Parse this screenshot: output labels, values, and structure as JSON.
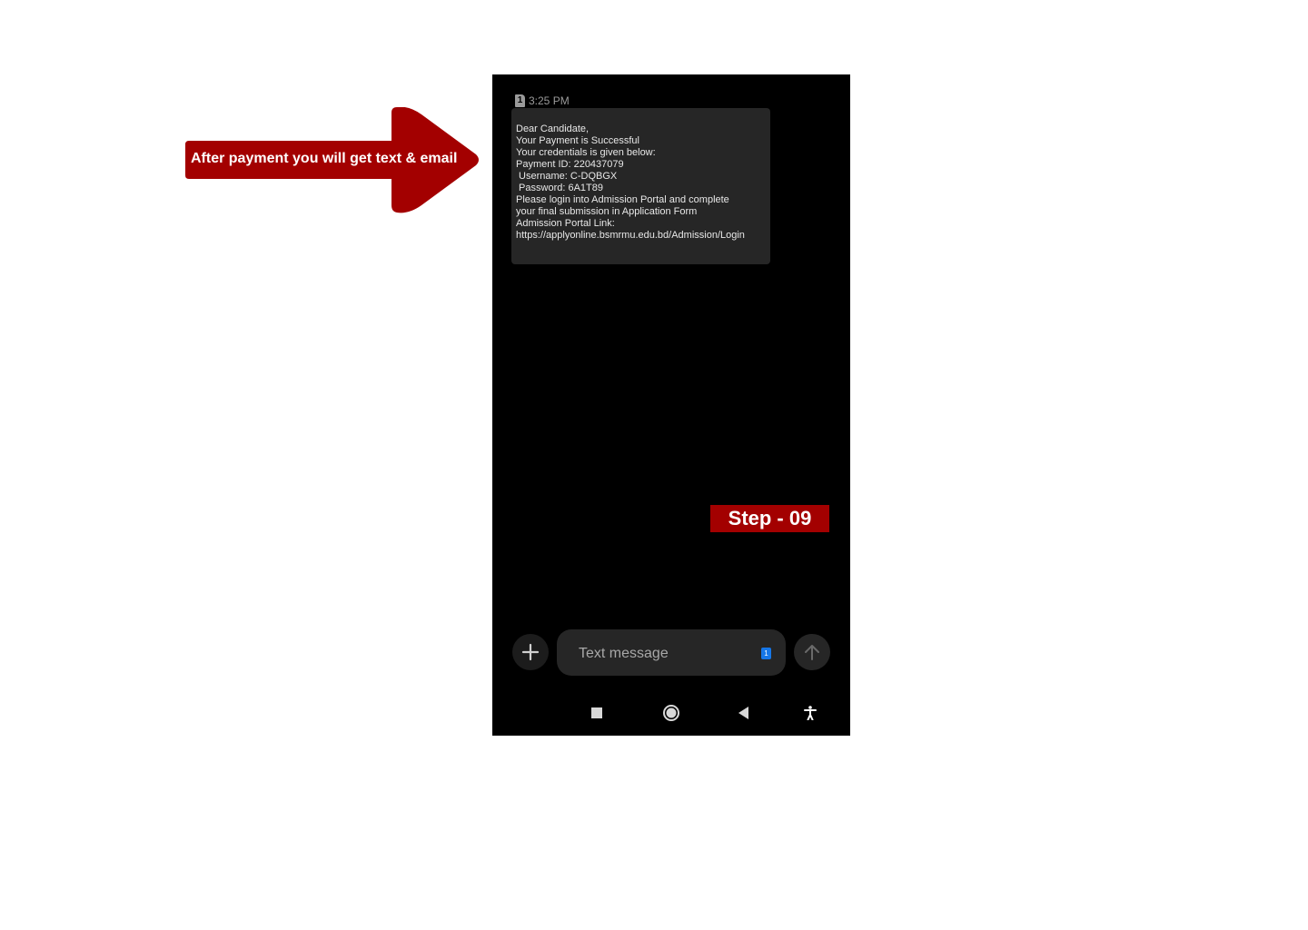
{
  "annotation": {
    "callout_text": "After payment you will get text & email",
    "step_label": "Step - 09"
  },
  "colors": {
    "accent": "#a30000",
    "screen_bg": "#000000",
    "bubble_bg": "#262626",
    "sim_chip": "#1677e8"
  },
  "sms": {
    "sim_number": "1",
    "time": "3:25 PM",
    "lines": [
      "Dear Candidate,",
      "Your Payment is Successful",
      "Your credentials is given below:",
      "Payment ID: 220437079",
      " Username: C-DQBGX",
      " Password: 6A1T89",
      "Please login into Admission Portal and complete",
      "your final submission in Application Form",
      "Admission Portal Link:",
      "https://applyonline.bsmrmu.edu.bd/Admission/Login"
    ]
  },
  "compose": {
    "placeholder": "Text message",
    "sim_chip": "1",
    "attach_icon": "plus-icon",
    "send_icon": "arrow-up-icon"
  },
  "navigation": {
    "icons": [
      "recents-square-icon",
      "home-circle-icon",
      "back-triangle-icon",
      "accessibility-icon"
    ]
  }
}
